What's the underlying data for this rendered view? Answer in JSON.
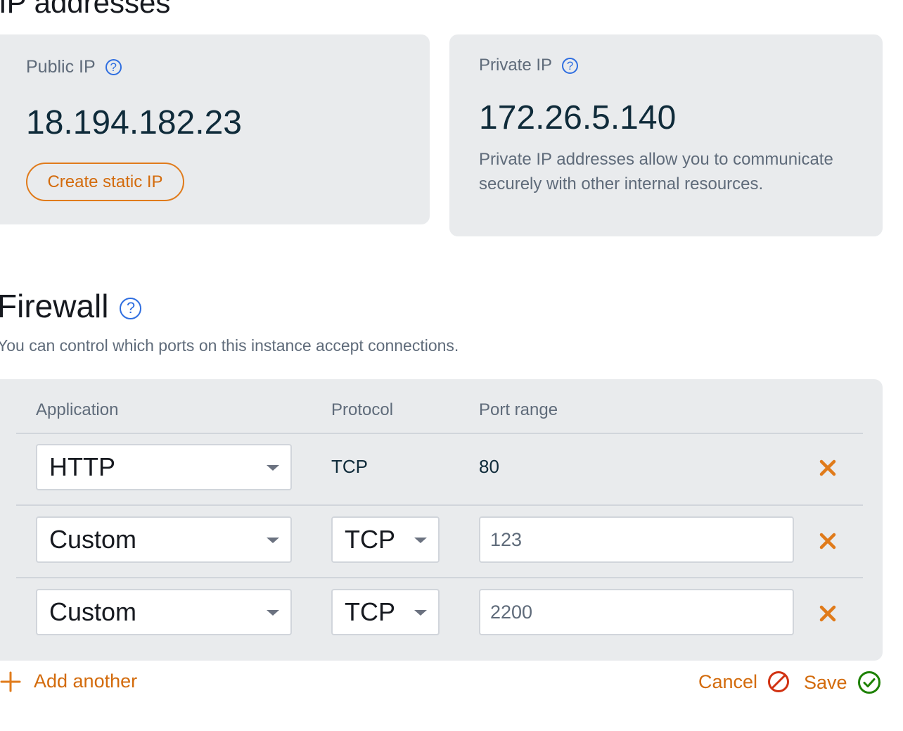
{
  "ip_section": {
    "title": "IP addresses",
    "public": {
      "label": "Public IP",
      "help": "?",
      "value": "18.194.182.23",
      "button_label": "Create static IP"
    },
    "private": {
      "label": "Private IP",
      "help": "?",
      "value": "172.26.5.140",
      "description": "Private IP addresses allow you to communicate securely with other internal resources."
    }
  },
  "firewall": {
    "title": "Firewall",
    "help": "?",
    "description": "You can control which ports on this instance accept connections.",
    "columns": {
      "application": "Application",
      "protocol": "Protocol",
      "port_range": "Port range"
    },
    "rows": [
      {
        "application": "HTTP",
        "protocol": "TCP",
        "port_range": "80",
        "editable": false
      },
      {
        "application": "Custom",
        "protocol": "TCP",
        "port_range": "123",
        "editable": true
      },
      {
        "application": "Custom",
        "protocol": "TCP",
        "port_range": "2200",
        "editable": true
      }
    ],
    "add_label": "Add another",
    "cancel_label": "Cancel",
    "save_label": "Save"
  },
  "colors": {
    "accent": "#d36b0c",
    "help_blue": "#2f6ee0",
    "cancel_red": "#d13212",
    "save_green": "#1d8102",
    "panel_bg": "#e9ebed"
  },
  "icons": {
    "help": "question-circle-icon",
    "remove": "close-x-icon",
    "add": "plus-icon",
    "cancel": "prohibited-icon",
    "save": "check-circle-icon",
    "dropdown": "caret-down-icon"
  }
}
